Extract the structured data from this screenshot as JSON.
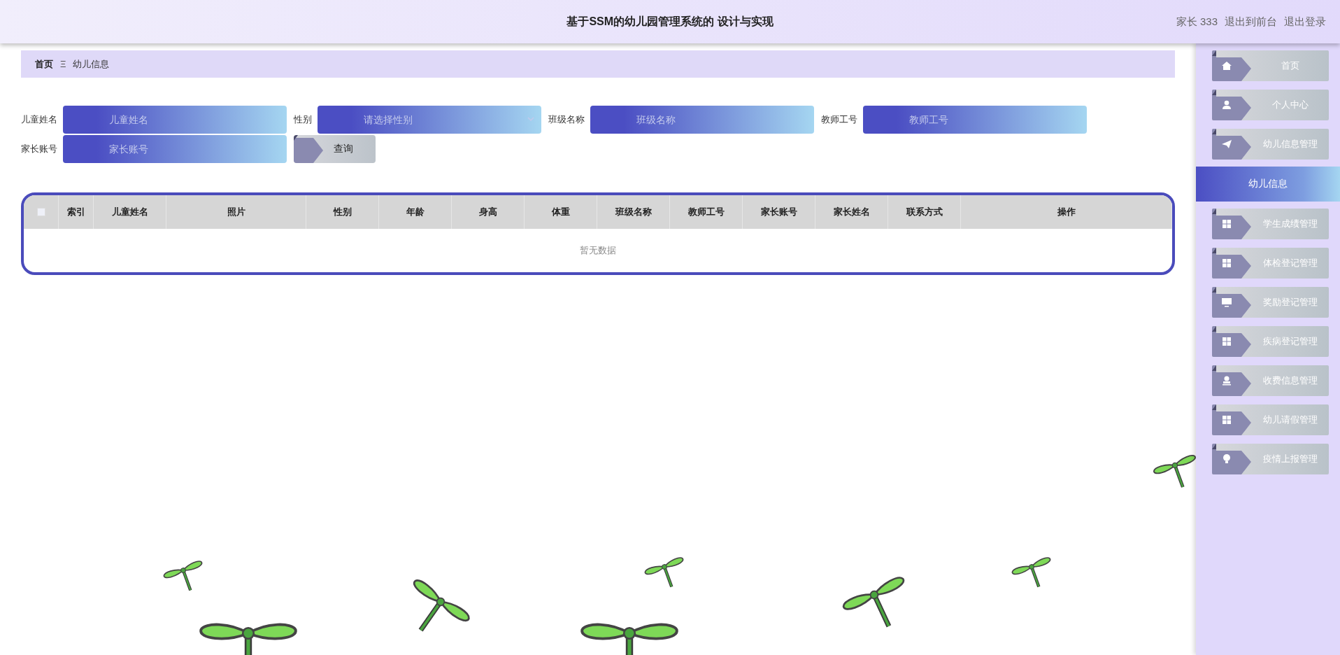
{
  "header": {
    "title": "基于SSM的幼儿园管理系统的 设计与实现",
    "user": "家长 333",
    "links": [
      "退出到前台",
      "退出登录"
    ]
  },
  "breadcrumb": {
    "items": [
      "首页",
      "幼儿信息"
    ],
    "separator": "Ξ"
  },
  "search_form": {
    "fields": [
      {
        "label": "儿童姓名",
        "placeholder": "儿童姓名",
        "kind": "input"
      },
      {
        "label": "性别",
        "placeholder": "请选择性别",
        "kind": "select"
      },
      {
        "label": "班级名称",
        "placeholder": "班级名称",
        "kind": "input"
      },
      {
        "label": "教师工号",
        "placeholder": "教师工号",
        "kind": "input"
      },
      {
        "label": "家长账号",
        "placeholder": "家长账号",
        "kind": "input"
      }
    ],
    "button": "查询"
  },
  "table": {
    "select_all_checked": false,
    "columns": [
      "索引",
      "儿童姓名",
      "照片",
      "性别",
      "年龄",
      "身高",
      "体重",
      "班级名称",
      "教师工号",
      "家长账号",
      "家长姓名",
      "联系方式",
      "操作"
    ],
    "empty_text": "暂无数据"
  },
  "sidebar": {
    "items": [
      {
        "label": "首页",
        "selected": false
      },
      {
        "label": "个人中心",
        "selected": false
      },
      {
        "label": "幼儿信息管理",
        "selected": false,
        "expanded": true,
        "children": [
          {
            "label": "幼儿信息",
            "selected": true
          }
        ]
      },
      {
        "label": "学生成绩管理",
        "selected": false
      },
      {
        "label": "体检登记管理",
        "selected": false
      },
      {
        "label": "奖励登记管理",
        "selected": false
      },
      {
        "label": "疾病登记管理",
        "selected": false
      },
      {
        "label": "收费信息管理",
        "selected": false
      },
      {
        "label": "幼儿请假管理",
        "selected": false
      },
      {
        "label": "疫情上报管理",
        "selected": false
      }
    ]
  }
}
